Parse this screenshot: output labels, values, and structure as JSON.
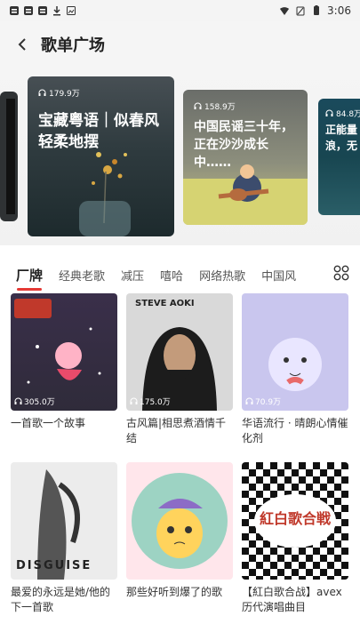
{
  "status_bar": {
    "left_icons": [
      "notification-icon",
      "notification-icon",
      "notification-icon",
      "download-icon",
      "image-icon"
    ],
    "time": "3:06"
  },
  "header": {
    "title": "歌单广场"
  },
  "banner": [
    {
      "play_count": "179.9万",
      "text": "宝藏粤语｜似春风轻柔地摆"
    },
    {
      "play_count": "158.9万",
      "text": "中国民谣三十年，正在沙沙成长中……"
    },
    {
      "play_count": "84.8万",
      "text": "正能量浪，无"
    }
  ],
  "tabs": [
    {
      "label": "厂牌",
      "active": true
    },
    {
      "label": "经典老歌"
    },
    {
      "label": "减压"
    },
    {
      "label": "嘻哈"
    },
    {
      "label": "网络热歌"
    },
    {
      "label": "中国风"
    }
  ],
  "playlists": [
    {
      "cover_label": "",
      "count": "305.0万",
      "caption": "一首歌一个故事",
      "color": "#3b3b5e"
    },
    {
      "cover_label": "STEVE AOKI",
      "count": "175.0万",
      "caption": "古风篇|相思煮酒情千结",
      "color": "#dcdcdc"
    },
    {
      "cover_label": "",
      "count": "70.9万",
      "caption": "华语流行 · 晴朗心情催化剂",
      "color": "#c6c3ee"
    },
    {
      "cover_label": "DISGUISE",
      "count": "",
      "caption": "最爱的永远是她/他的下一首歌",
      "color": "#e8e8e8"
    },
    {
      "cover_label": "",
      "count": "",
      "caption": "那些好听到爆了的歌",
      "color": "#ffe1e6"
    },
    {
      "cover_label": "紅白歌合戦",
      "count": "",
      "caption": "【紅白歌合战】avex 历代演唱曲目",
      "color": "#ffffff"
    }
  ]
}
